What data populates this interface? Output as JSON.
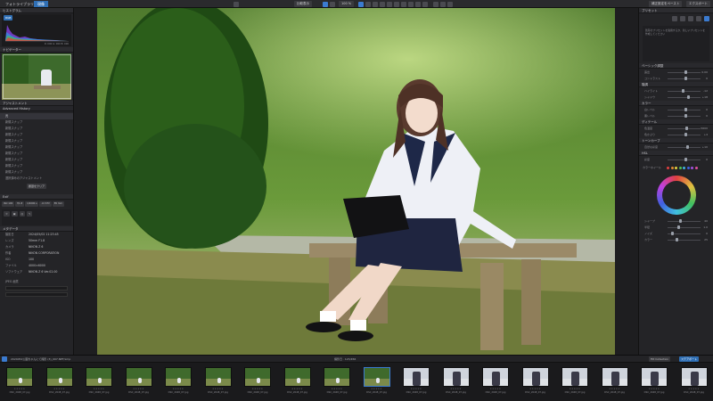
{
  "topbar": {
    "tabs": [
      {
        "label": "フォトライブラリ",
        "active": false
      },
      {
        "label": "現像",
        "active": true
      }
    ],
    "compare_label": "比較表示",
    "zoom_label": "100 %",
    "right_buttons": [
      {
        "label": "補正設定をペースト"
      },
      {
        "label": "エクスポート"
      }
    ]
  },
  "left_panel": {
    "histogram_title": "ヒストグラム",
    "histogram_tag": "RGB",
    "histogram_values": "R: 000 G: 000 B: 000",
    "navigator_title": "ナビゲーター",
    "adjustment_title": "アジャストメント",
    "history_title": "Advanced History",
    "history_items": [
      {
        "label": "元",
        "selected": true
      },
      {
        "label": "新規スナップ"
      },
      {
        "label": "新規スナップ"
      },
      {
        "label": "新規スナップ"
      },
      {
        "label": "新規スナップ"
      },
      {
        "label": "新規スナップ"
      },
      {
        "label": "新規スナップ"
      },
      {
        "label": "新規スナップ"
      },
      {
        "label": "新規スナップ"
      },
      {
        "label": "新規スナップ"
      },
      {
        "label": "選択済みのアジャストメント"
      }
    ],
    "history_button": "履歴をクリア",
    "exif_title": "Exif",
    "exif_values": [
      "ISO 100",
      "f/1.8",
      "1/2000 s",
      "-0.3 EV",
      "85 mm"
    ],
    "meta_title": "メタデータ",
    "meta_rows": [
      {
        "key": "撮影日",
        "value": "2024/05/02 11:23:45"
      },
      {
        "key": "レンズ",
        "value": "50mm F1.8"
      },
      {
        "key": "カメラ",
        "value": "NIKON Z 6"
      },
      {
        "key": "作者",
        "value": "NIKON CORPORATION"
      },
      {
        "key": "ISO",
        "value": "100"
      },
      {
        "key": "ファイル",
        "value": "4000×6000"
      },
      {
        "key": "ソフトウェア",
        "value": "NIKON Z 6 Ver.02.00"
      }
    ],
    "bottom_label": "JPEG 画質"
  },
  "right_panel": {
    "preset_title": "プリセット",
    "preset_text": "既存のプリセットを適用するか、新しいプリセットを作成してください",
    "sections": [
      {
        "title": "ベーシック調整"
      },
      {
        "title": "階調"
      },
      {
        "title": "カラー"
      },
      {
        "title": "ディテール"
      },
      {
        "title": "トーンカーブ"
      },
      {
        "title": "HSL"
      }
    ],
    "sliders": [
      {
        "label": "露出",
        "value": "0.00",
        "pos": 0.5
      },
      {
        "label": "コントラスト",
        "value": "0",
        "pos": 0.5
      },
      {
        "label": "ハイライト",
        "value": "-12",
        "pos": 0.42
      },
      {
        "label": "シャドウ",
        "value": "+18",
        "pos": 0.6
      },
      {
        "label": "白レベル",
        "value": "0",
        "pos": 0.5
      },
      {
        "label": "黒レベル",
        "value": "0",
        "pos": 0.5
      },
      {
        "label": "色温度",
        "value": "5600",
        "pos": 0.55
      },
      {
        "label": "色かぶり",
        "value": "+4",
        "pos": 0.52
      },
      {
        "label": "自然な彩度",
        "value": "+10",
        "pos": 0.58
      },
      {
        "label": "彩度",
        "value": "0",
        "pos": 0.5
      }
    ],
    "color_label": "カラーホイール",
    "detail_sliders": [
      {
        "label": "シャープ",
        "value": "40",
        "pos": 0.35
      },
      {
        "label": "半径",
        "value": "1.0",
        "pos": 0.3
      },
      {
        "label": "ノイズ",
        "value": "0",
        "pos": 0.1
      },
      {
        "label": "カラー",
        "value": "25",
        "pos": 0.25
      }
    ]
  },
  "filmstrip": {
    "header": "2024052公園ちゃんにて撮影 (3)_007.NEF/xmp",
    "count": "撮影日 · 123/456",
    "right_buttons": [
      {
        "label": "Filt Collection"
      },
      {
        "label": "ステアポート"
      }
    ],
    "items": [
      {
        "label": "DSC_2048_07.jpg",
        "kind": "green"
      },
      {
        "label": "DSC_2048_07.jpg",
        "kind": "green"
      },
      {
        "label": "DSC_2048_07.jpg",
        "kind": "green"
      },
      {
        "label": "DSC_2048_07.jpg",
        "kind": "green"
      },
      {
        "label": "DSC_2048_07.jpg",
        "kind": "green"
      },
      {
        "label": "DSC_2048_07.jpg",
        "kind": "green"
      },
      {
        "label": "DSC_2048_07.jpg",
        "kind": "green"
      },
      {
        "label": "DSC_2048_07.jpg",
        "kind": "green"
      },
      {
        "label": "DSC_2048_07.jpg",
        "kind": "green"
      },
      {
        "label": "DSC_2048_07.jpg",
        "kind": "green",
        "selected": true
      },
      {
        "label": "DSC_2048_07.jpg",
        "kind": "portrait"
      },
      {
        "label": "DSC_2048_07.jpg",
        "kind": "portrait"
      },
      {
        "label": "DSC_2048_07.jpg",
        "kind": "portrait"
      },
      {
        "label": "DSC_2048_07.jpg",
        "kind": "portrait"
      },
      {
        "label": "DSC_2048_07.jpg",
        "kind": "portrait"
      },
      {
        "label": "DSC_2048_07.jpg",
        "kind": "portrait"
      },
      {
        "label": "DSC_2048_07.jpg",
        "kind": "portrait"
      },
      {
        "label": "DSC_2048_07.jpg",
        "kind": "portrait"
      }
    ]
  },
  "colors": {
    "accent": "#2f6fb5",
    "panel": "#242427",
    "dark": "#1b1b1d"
  }
}
